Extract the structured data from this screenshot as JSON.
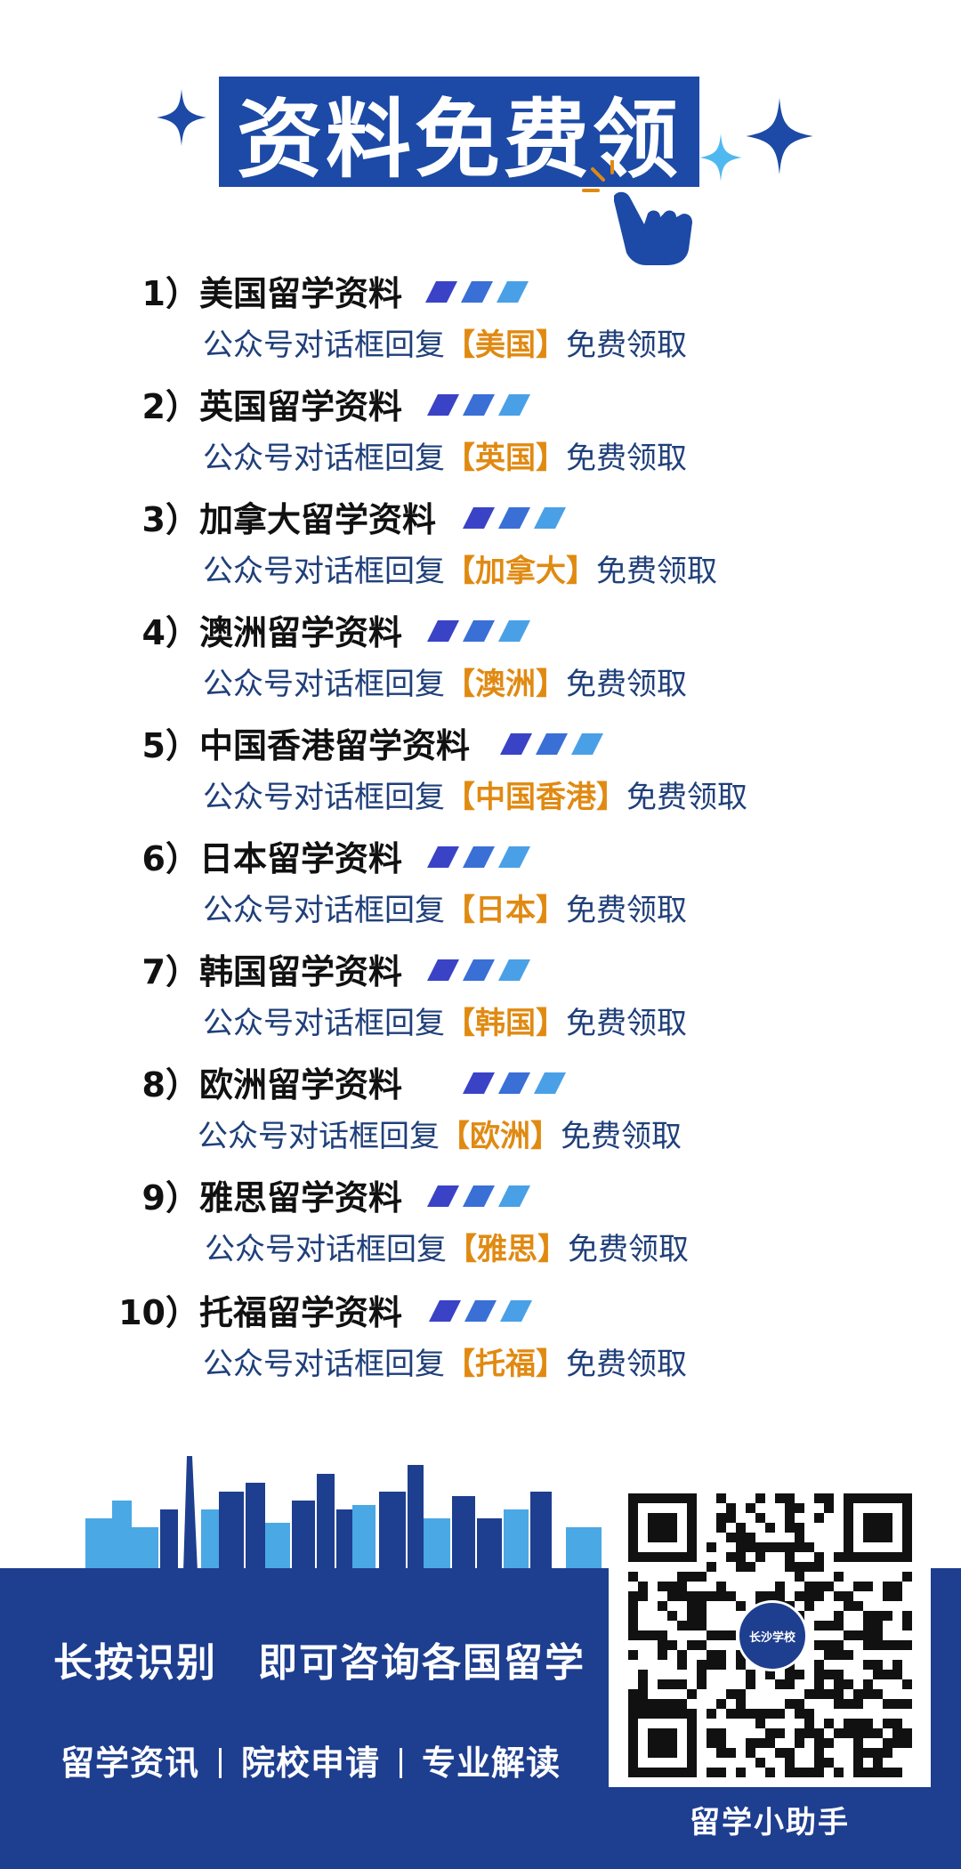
{
  "header": {
    "title": "资料免费领",
    "colors": {
      "title_bg": "#1c4aa6",
      "sparkle": "#1c4aa6",
      "sparkle_light": "#4fb8f0"
    },
    "icons": [
      "sparkle-icon",
      "pointing-hand-icon"
    ]
  },
  "items": [
    {
      "num": "1）",
      "title": "美国留学资料",
      "prefix": "公众号对话框回复",
      "keyword": "【美国】",
      "suffix": "免费领取"
    },
    {
      "num": "2）",
      "title": "英国留学资料",
      "prefix": "公众号对话框回复",
      "keyword": "【英国】",
      "suffix": "免费领取"
    },
    {
      "num": "3）",
      "title": "加拿大留学资料",
      "prefix": "公众号对话框回复",
      "keyword": "【加拿大】",
      "suffix": "免费领取"
    },
    {
      "num": "4）",
      "title": "澳洲留学资料",
      "prefix": "公众号对话框回复",
      "keyword": "【澳洲】",
      "suffix": "免费领取"
    },
    {
      "num": "5）",
      "title": "中国香港留学资料",
      "prefix": "公众号对话框回复",
      "keyword": "【中国香港】",
      "suffix": "免费领取"
    },
    {
      "num": "6）",
      "title": "日本留学资料",
      "prefix": "公众号对话框回复",
      "keyword": "【日本】",
      "suffix": "免费领取"
    },
    {
      "num": "7）",
      "title": "韩国留学资料",
      "prefix": "公众号对话框回复",
      "keyword": "【韩国】",
      "suffix": "免费领取"
    },
    {
      "num": "8）",
      "title": "欧洲留学资料",
      "prefix": "公众号对话框回复",
      "keyword": "【欧洲】",
      "suffix": "免费领取"
    },
    {
      "num": "9）",
      "title": "雅思留学资料",
      "prefix": "公众号对话框回复",
      "keyword": "【雅思】",
      "suffix": "免费领取"
    },
    {
      "num": "10）",
      "title": "托福留学资料",
      "prefix": "公众号对话框回复",
      "keyword": "【托福】",
      "suffix": "免费领取"
    }
  ],
  "footer": {
    "main_left": "长按识别",
    "main_right": "即可咨询各国留学",
    "links": [
      "留学资讯",
      "院校申请",
      "专业解读"
    ],
    "qr_center_text": "长沙学校",
    "qr_caption": "留学小助手",
    "colors": {
      "band": "#1e3e8f",
      "keyword": "#e08a12",
      "stripe_dark": "#2d3fb8",
      "stripe_light": "#3d9be0"
    }
  }
}
